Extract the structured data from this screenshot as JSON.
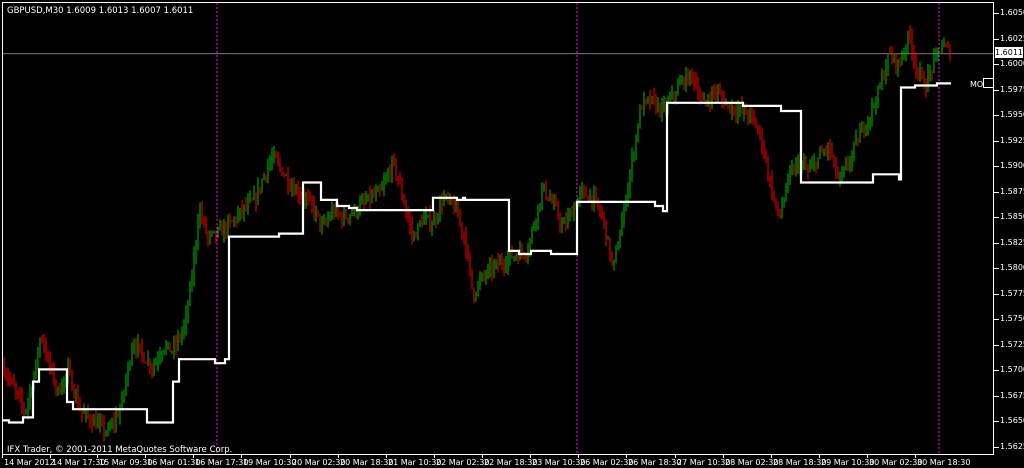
{
  "header": {
    "symbol_line": "GBPUSD,M30  1.6009 1.6013 1.6007 1.6011"
  },
  "footer": {
    "copyright": "IFX Trader, © 2001-2011 MetaQuotes Software Corp."
  },
  "price_axis": {
    "labels": [
      "1.6050",
      "1.6025",
      "1.6000",
      "1.5975",
      "1.5950",
      "1.5925",
      "1.5900",
      "1.5875",
      "1.5850",
      "1.5825",
      "1.5800",
      "1.5775",
      "1.5750",
      "1.5725",
      "1.5700",
      "1.5675",
      "1.5650",
      "1.5625"
    ],
    "current_price": "1.6011"
  },
  "time_axis": {
    "labels": [
      "14 Mar 2012",
      "14 Mar 17:30",
      "15 Mar 09:30",
      "16 Mar 01:30",
      "16 Mar 17:30",
      "19 Mar 10:30",
      "20 Mar 02:30",
      "20 Mar 18:30",
      "21 Mar 10:30",
      "22 Mar 02:30",
      "22 Mar 18:30",
      "23 Mar 10:30",
      "26 Mar 02:30",
      "26 Mar 18:30",
      "27 Mar 10:30",
      "28 Mar 02:30",
      "28 Mar 18:30",
      "29 Mar 10:30",
      "30 Mar 02:30",
      "30 Mar 18:30"
    ]
  },
  "indicator": {
    "label": "MO"
  },
  "colors": {
    "background": "#000000",
    "bull_candle": "#00c000",
    "bear_candle": "#ff0000",
    "ma_line": "#ffffff",
    "separator": "#ff00ff",
    "axis": "#ffffff"
  },
  "chart_data": {
    "type": "candlestick",
    "symbol": "GBPUSD",
    "timeframe": "M30",
    "ylim": [
      1.5618,
      1.6058
    ],
    "current_price": 1.6011,
    "ohlc_last": {
      "open": 1.6009,
      "high": 1.6013,
      "low": 1.6007,
      "close": 1.6011
    },
    "price_path": [
      [
        0,
        1.5705
      ],
      [
        10,
        1.5685
      ],
      [
        22,
        1.566
      ],
      [
        32,
        1.57
      ],
      [
        38,
        1.5738
      ],
      [
        45,
        1.571
      ],
      [
        55,
        1.568
      ],
      [
        65,
        1.57
      ],
      [
        78,
        1.566
      ],
      [
        92,
        1.565
      ],
      [
        105,
        1.564
      ],
      [
        118,
        1.5665
      ],
      [
        130,
        1.573
      ],
      [
        140,
        1.5715
      ],
      [
        150,
        1.5705
      ],
      [
        160,
        1.5725
      ],
      [
        170,
        1.572
      ],
      [
        182,
        1.5745
      ],
      [
        190,
        1.58
      ],
      [
        196,
        1.586
      ],
      [
        205,
        1.583
      ],
      [
        215,
        1.5835
      ],
      [
        228,
        1.5845
      ],
      [
        240,
        1.5858
      ],
      [
        252,
        1.5868
      ],
      [
        262,
        1.5895
      ],
      [
        270,
        1.591
      ],
      [
        280,
        1.5895
      ],
      [
        290,
        1.588
      ],
      [
        300,
        1.5872
      ],
      [
        310,
        1.586
      ],
      [
        320,
        1.584
      ],
      [
        330,
        1.5858
      ],
      [
        340,
        1.585
      ],
      [
        355,
        1.586
      ],
      [
        368,
        1.587
      ],
      [
        378,
        1.5875
      ],
      [
        390,
        1.5905
      ],
      [
        400,
        1.587
      ],
      [
        410,
        1.583
      ],
      [
        420,
        1.585
      ],
      [
        430,
        1.5845
      ],
      [
        440,
        1.587
      ],
      [
        452,
        1.586
      ],
      [
        462,
        1.583
      ],
      [
        470,
        1.5775
      ],
      [
        478,
        1.579
      ],
      [
        488,
        1.58
      ],
      [
        500,
        1.5808
      ],
      [
        515,
        1.5815
      ],
      [
        525,
        1.582
      ],
      [
        532,
        1.585
      ],
      [
        540,
        1.588
      ],
      [
        552,
        1.586
      ],
      [
        560,
        1.584
      ],
      [
        568,
        1.5855
      ],
      [
        578,
        1.5875
      ],
      [
        590,
        1.587
      ],
      [
        600,
        1.585
      ],
      [
        610,
        1.58
      ],
      [
        618,
        1.584
      ],
      [
        628,
        1.59
      ],
      [
        638,
        1.596
      ],
      [
        648,
        1.5965
      ],
      [
        660,
        1.5955
      ],
      [
        670,
        1.597
      ],
      [
        680,
        1.5985
      ],
      [
        690,
        1.599
      ],
      [
        700,
        1.596
      ],
      [
        712,
        1.5975
      ],
      [
        725,
        1.596
      ],
      [
        738,
        1.5955
      ],
      [
        748,
        1.595
      ],
      [
        758,
        1.593
      ],
      [
        768,
        1.588
      ],
      [
        776,
        1.585
      ],
      [
        786,
        1.589
      ],
      [
        796,
        1.5905
      ],
      [
        806,
        1.5895
      ],
      [
        816,
        1.591
      ],
      [
        826,
        1.592
      ],
      [
        836,
        1.5885
      ],
      [
        846,
        1.5905
      ],
      [
        856,
        1.593
      ],
      [
        866,
        1.595
      ],
      [
        876,
        1.5975
      ],
      [
        886,
        1.601
      ],
      [
        896,
        1.6
      ],
      [
        906,
        1.603
      ],
      [
        914,
        1.5995
      ],
      [
        922,
        1.598
      ],
      [
        930,
        1.6
      ],
      [
        938,
        1.602
      ],
      [
        944,
        1.6015
      ],
      [
        948,
        1.6011
      ]
    ],
    "ma_steps": [
      [
        0,
        1.5652
      ],
      [
        6,
        1.565
      ],
      [
        20,
        1.5655
      ],
      [
        30,
        1.569
      ],
      [
        36,
        1.5702
      ],
      [
        60,
        1.5702
      ],
      [
        64,
        1.567
      ],
      [
        70,
        1.5663
      ],
      [
        140,
        1.5663
      ],
      [
        144,
        1.565
      ],
      [
        160,
        1.565
      ],
      [
        170,
        1.569
      ],
      [
        176,
        1.5712
      ],
      [
        206,
        1.5712
      ],
      [
        212,
        1.5708
      ],
      [
        222,
        1.5712
      ],
      [
        226,
        1.5832
      ],
      [
        276,
        1.5835
      ],
      [
        298,
        1.5835
      ],
      [
        300,
        1.5885
      ],
      [
        316,
        1.5885
      ],
      [
        318,
        1.5868
      ],
      [
        330,
        1.5868
      ],
      [
        334,
        1.5862
      ],
      [
        346,
        1.586
      ],
      [
        354,
        1.5858
      ],
      [
        424,
        1.5858
      ],
      [
        430,
        1.587
      ],
      [
        450,
        1.587
      ],
      [
        454,
        1.5868
      ],
      [
        460,
        1.587
      ],
      [
        462,
        1.5868
      ],
      [
        504,
        1.5868
      ],
      [
        506,
        1.5818
      ],
      [
        516,
        1.5815
      ],
      [
        528,
        1.5818
      ],
      [
        536,
        1.5818
      ],
      [
        548,
        1.5815
      ],
      [
        572,
        1.5815
      ],
      [
        574,
        1.5866
      ],
      [
        596,
        1.5866
      ],
      [
        608,
        1.5866
      ],
      [
        650,
        1.5866
      ],
      [
        652,
        1.5862
      ],
      [
        660,
        1.5857
      ],
      [
        664,
        1.5963
      ],
      [
        712,
        1.5963
      ],
      [
        740,
        1.596
      ],
      [
        772,
        1.596
      ],
      [
        778,
        1.5955
      ],
      [
        796,
        1.5955
      ],
      [
        798,
        1.5885
      ],
      [
        866,
        1.5885
      ],
      [
        870,
        1.5893
      ],
      [
        892,
        1.5893
      ],
      [
        896,
        1.5888
      ],
      [
        898,
        1.5978
      ],
      [
        912,
        1.598
      ],
      [
        934,
        1.5982
      ],
      [
        948,
        1.5982
      ]
    ],
    "separators_x": [
      214,
      574,
      936
    ]
  }
}
